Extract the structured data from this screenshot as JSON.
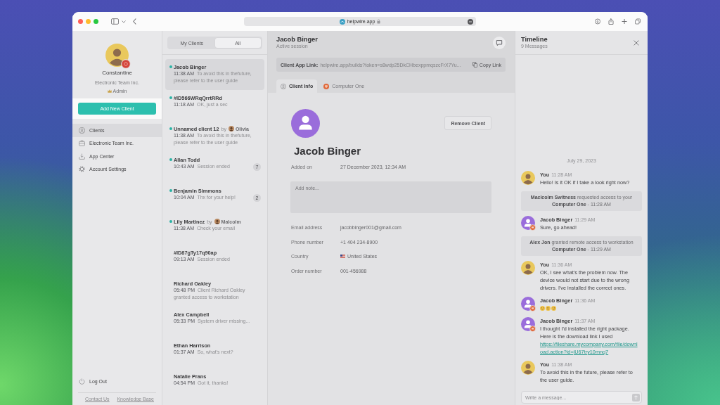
{
  "browser": {
    "address": "helpwire.app"
  },
  "profile": {
    "name": "Constantine",
    "company": "Electronic Team Inc.",
    "role": "Admin",
    "add_button": "Add New Client"
  },
  "nav": [
    {
      "label": "Clients",
      "kind": "clients",
      "selected": true
    },
    {
      "label": "Electronic Team Inc.",
      "kind": "company",
      "selected": false
    },
    {
      "label": "App Center",
      "kind": "apps",
      "selected": false
    },
    {
      "label": "Account Settings",
      "kind": "settings",
      "selected": false
    }
  ],
  "logout": "Log Out",
  "footer_links": [
    "Contact Us",
    "Knowledge Base"
  ],
  "client_tabs": [
    {
      "label": "My Clients",
      "selected": false
    },
    {
      "label": "All",
      "selected": true
    }
  ],
  "clients": [
    {
      "name": "Jacob Binger",
      "online": true,
      "selected": true,
      "time": "11:38 AM",
      "message": "To avoid this in thefuture, please refer to the user guide"
    },
    {
      "name": "#ID566WRqQrrtRRd",
      "online": true,
      "selected": false,
      "time": "11:18 AM",
      "message": "OK, just a sec"
    },
    {
      "name": "Unnamed client 12",
      "assigned_prefix": "by",
      "agent": "Olivia",
      "online": true,
      "selected": false,
      "time": "11:38 AM",
      "message": "To avoid this in thefuture, please refer to the user guide"
    },
    {
      "name": "Allan Todd",
      "online": true,
      "selected": false,
      "time": "10:43 AM",
      "message": "Session ended",
      "unread": "7"
    },
    {
      "name": "Benjamin Simmons",
      "online": true,
      "selected": false,
      "time": "10:04 AM",
      "message": "Thx for your help!",
      "unread": "2"
    },
    {
      "name": "Lily Martinez",
      "assigned_prefix": "by",
      "agent": "Malcolm",
      "online": true,
      "selected": false,
      "time": "11:38 AM",
      "message": "Check your email"
    },
    {
      "name": "#ID87gTy17q90ap",
      "online": false,
      "selected": false,
      "time": "09:13 AM",
      "message": "Session ended"
    },
    {
      "name": "Richard Oakley",
      "online": false,
      "selected": false,
      "time": "05:48 PM",
      "message": "Client Richard Oakley granted access to workstation"
    },
    {
      "name": "Alex Campbell",
      "online": false,
      "selected": false,
      "time": "05:33 PM",
      "message": "System driver missing..."
    },
    {
      "name": "Ethan Harrison",
      "online": false,
      "selected": false,
      "time": "01:37 AM",
      "message": "So, what's next?"
    },
    {
      "name": "Natalie Prans",
      "online": false,
      "selected": false,
      "time": "04:54 PM",
      "message": "Got it, thanks!"
    }
  ],
  "client": {
    "name": "Jacob Binger",
    "status": "Active session",
    "link_label": "Client App Link:",
    "link": "helpwire.app/builds?token=s8wdp25DkCHbexppmqszcFrX7Yu...",
    "copy_button": "Copy Link",
    "tabs": [
      {
        "label": "Client Info",
        "kind": "info",
        "selected": true
      },
      {
        "label": "Computer One",
        "kind": "computer",
        "selected": false
      }
    ],
    "remove_button": "Remove Client",
    "heading": "Jacob Binger",
    "added": {
      "label": "Added on",
      "value": "27 December 2023, 12:34 AM"
    },
    "note": {
      "placeholder": "Add note..."
    },
    "fields": [
      {
        "label": "Email address",
        "kind": "text",
        "value": "jacobbinger001@gmail.com"
      },
      {
        "label": "Phone number",
        "kind": "text",
        "value": "+1 404 234-8900"
      },
      {
        "label": "Country",
        "kind": "country",
        "value": "United States"
      },
      {
        "label": "Order number",
        "kind": "text",
        "value": "001-456988"
      }
    ]
  },
  "timeline": {
    "title": "Timeline",
    "count": "9 Messages",
    "date": "July 29, 2023",
    "items": [
      {
        "kind": "message",
        "outgoing": true,
        "sender": "You",
        "time": "11:28 AM",
        "text": "Hello! Is it OK if I take a look right now?"
      },
      {
        "kind": "event",
        "text": "**Maclcolm Switness** requested access to your **Computer One** - 11:28 AM"
      },
      {
        "kind": "message",
        "outgoing": false,
        "sender": "Jacob Binger",
        "time": "11:29 AM",
        "text": "Sure, go ahead!"
      },
      {
        "kind": "event",
        "text": "**Alex Jon** granted remote access to workstation **Computer One** - 11:29 AM"
      },
      {
        "kind": "message",
        "outgoing": true,
        "sender": "You",
        "time": "11:36 AM",
        "text": "OK, I see what's the problem now. The device would not start due to the wrong drivers. I've installed the correct ones."
      },
      {
        "kind": "emoji",
        "outgoing": false,
        "sender": "Jacob Binger",
        "time": "11:36 AM"
      },
      {
        "kind": "message",
        "outgoing": false,
        "sender": "Jacob Binger",
        "time": "11:37 AM",
        "text": "I thought I'd installed the right package. Here is the download link I used",
        "link": "https://fileshare.mycompany.com/file/download.action?id=jU67try10mnq7"
      },
      {
        "kind": "message",
        "outgoing": true,
        "sender": "You",
        "time": "11:38 AM",
        "text": "To avoid this in the future, please refer to the user guide."
      }
    ],
    "composer": {
      "placeholder": "Write a message..."
    }
  }
}
